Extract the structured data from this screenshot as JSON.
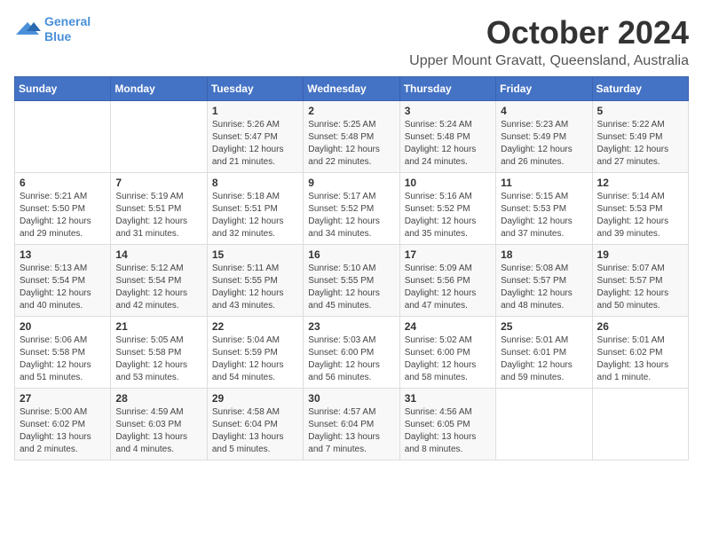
{
  "logo": {
    "line1": "General",
    "line2": "Blue"
  },
  "title": "October 2024",
  "subtitle": "Upper Mount Gravatt, Queensland, Australia",
  "days_of_week": [
    "Sunday",
    "Monday",
    "Tuesday",
    "Wednesday",
    "Thursday",
    "Friday",
    "Saturday"
  ],
  "weeks": [
    [
      {
        "day": "",
        "detail": ""
      },
      {
        "day": "",
        "detail": ""
      },
      {
        "day": "1",
        "detail": "Sunrise: 5:26 AM\nSunset: 5:47 PM\nDaylight: 12 hours and 21 minutes."
      },
      {
        "day": "2",
        "detail": "Sunrise: 5:25 AM\nSunset: 5:48 PM\nDaylight: 12 hours and 22 minutes."
      },
      {
        "day": "3",
        "detail": "Sunrise: 5:24 AM\nSunset: 5:48 PM\nDaylight: 12 hours and 24 minutes."
      },
      {
        "day": "4",
        "detail": "Sunrise: 5:23 AM\nSunset: 5:49 PM\nDaylight: 12 hours and 26 minutes."
      },
      {
        "day": "5",
        "detail": "Sunrise: 5:22 AM\nSunset: 5:49 PM\nDaylight: 12 hours and 27 minutes."
      }
    ],
    [
      {
        "day": "6",
        "detail": "Sunrise: 5:21 AM\nSunset: 5:50 PM\nDaylight: 12 hours and 29 minutes."
      },
      {
        "day": "7",
        "detail": "Sunrise: 5:19 AM\nSunset: 5:51 PM\nDaylight: 12 hours and 31 minutes."
      },
      {
        "day": "8",
        "detail": "Sunrise: 5:18 AM\nSunset: 5:51 PM\nDaylight: 12 hours and 32 minutes."
      },
      {
        "day": "9",
        "detail": "Sunrise: 5:17 AM\nSunset: 5:52 PM\nDaylight: 12 hours and 34 minutes."
      },
      {
        "day": "10",
        "detail": "Sunrise: 5:16 AM\nSunset: 5:52 PM\nDaylight: 12 hours and 35 minutes."
      },
      {
        "day": "11",
        "detail": "Sunrise: 5:15 AM\nSunset: 5:53 PM\nDaylight: 12 hours and 37 minutes."
      },
      {
        "day": "12",
        "detail": "Sunrise: 5:14 AM\nSunset: 5:53 PM\nDaylight: 12 hours and 39 minutes."
      }
    ],
    [
      {
        "day": "13",
        "detail": "Sunrise: 5:13 AM\nSunset: 5:54 PM\nDaylight: 12 hours and 40 minutes."
      },
      {
        "day": "14",
        "detail": "Sunrise: 5:12 AM\nSunset: 5:54 PM\nDaylight: 12 hours and 42 minutes."
      },
      {
        "day": "15",
        "detail": "Sunrise: 5:11 AM\nSunset: 5:55 PM\nDaylight: 12 hours and 43 minutes."
      },
      {
        "day": "16",
        "detail": "Sunrise: 5:10 AM\nSunset: 5:55 PM\nDaylight: 12 hours and 45 minutes."
      },
      {
        "day": "17",
        "detail": "Sunrise: 5:09 AM\nSunset: 5:56 PM\nDaylight: 12 hours and 47 minutes."
      },
      {
        "day": "18",
        "detail": "Sunrise: 5:08 AM\nSunset: 5:57 PM\nDaylight: 12 hours and 48 minutes."
      },
      {
        "day": "19",
        "detail": "Sunrise: 5:07 AM\nSunset: 5:57 PM\nDaylight: 12 hours and 50 minutes."
      }
    ],
    [
      {
        "day": "20",
        "detail": "Sunrise: 5:06 AM\nSunset: 5:58 PM\nDaylight: 12 hours and 51 minutes."
      },
      {
        "day": "21",
        "detail": "Sunrise: 5:05 AM\nSunset: 5:58 PM\nDaylight: 12 hours and 53 minutes."
      },
      {
        "day": "22",
        "detail": "Sunrise: 5:04 AM\nSunset: 5:59 PM\nDaylight: 12 hours and 54 minutes."
      },
      {
        "day": "23",
        "detail": "Sunrise: 5:03 AM\nSunset: 6:00 PM\nDaylight: 12 hours and 56 minutes."
      },
      {
        "day": "24",
        "detail": "Sunrise: 5:02 AM\nSunset: 6:00 PM\nDaylight: 12 hours and 58 minutes."
      },
      {
        "day": "25",
        "detail": "Sunrise: 5:01 AM\nSunset: 6:01 PM\nDaylight: 12 hours and 59 minutes."
      },
      {
        "day": "26",
        "detail": "Sunrise: 5:01 AM\nSunset: 6:02 PM\nDaylight: 13 hours and 1 minute."
      }
    ],
    [
      {
        "day": "27",
        "detail": "Sunrise: 5:00 AM\nSunset: 6:02 PM\nDaylight: 13 hours and 2 minutes."
      },
      {
        "day": "28",
        "detail": "Sunrise: 4:59 AM\nSunset: 6:03 PM\nDaylight: 13 hours and 4 minutes."
      },
      {
        "day": "29",
        "detail": "Sunrise: 4:58 AM\nSunset: 6:04 PM\nDaylight: 13 hours and 5 minutes."
      },
      {
        "day": "30",
        "detail": "Sunrise: 4:57 AM\nSunset: 6:04 PM\nDaylight: 13 hours and 7 minutes."
      },
      {
        "day": "31",
        "detail": "Sunrise: 4:56 AM\nSunset: 6:05 PM\nDaylight: 13 hours and 8 minutes."
      },
      {
        "day": "",
        "detail": ""
      },
      {
        "day": "",
        "detail": ""
      }
    ]
  ]
}
